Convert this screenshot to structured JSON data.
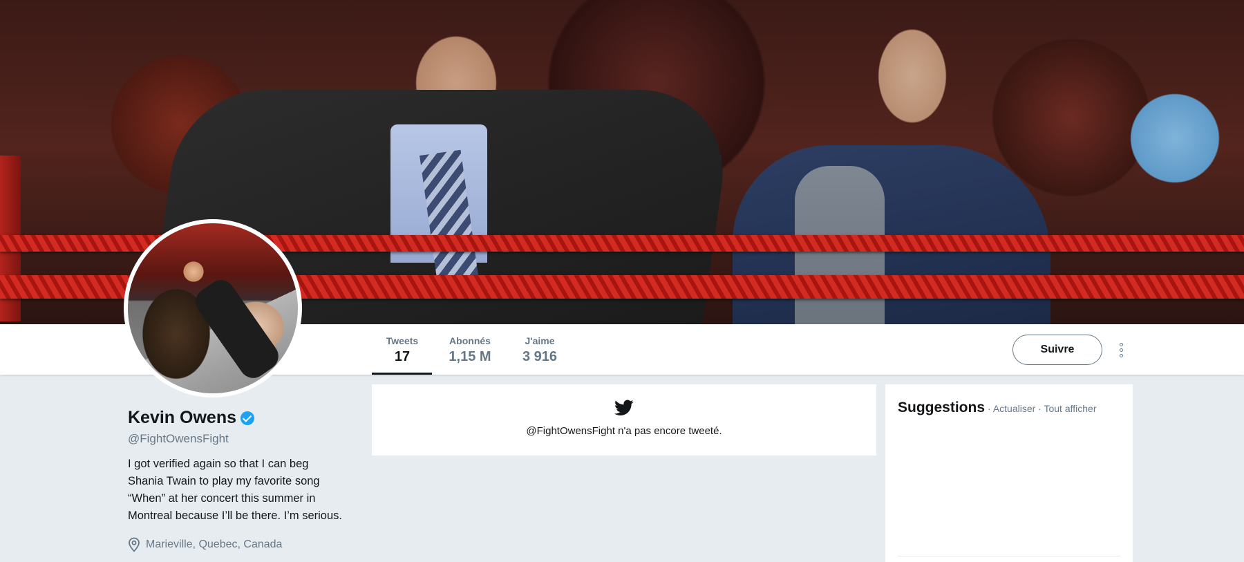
{
  "profile": {
    "name": "Kevin Owens",
    "handle": "@FightOwensFight",
    "verified": true,
    "bio": "I got verified again so that I can beg\nShania Twain to play my favorite song\n“When” at her concert this summer in\nMontreal because I’ll be there. I’m serious.",
    "location": "Marieville, Quebec, Canada",
    "location_icon": "map-pin-icon"
  },
  "nav": {
    "stats": [
      {
        "label": "Tweets",
        "value": "17",
        "active": true
      },
      {
        "label": "Abonnés",
        "value": "1,15 M",
        "active": false
      },
      {
        "label": "J'aime",
        "value": "3 916",
        "active": false
      }
    ],
    "follow_label": "Suivre",
    "more_icon": "more-vertical-icon"
  },
  "timeline": {
    "icon": "twitter-bird-icon",
    "empty_message": "@FightOwensFight n'a pas encore tweeté."
  },
  "suggestions": {
    "title": "Suggestions",
    "refresh_label": "Actualiser",
    "separator": "·",
    "view_all_label": "Tout afficher"
  },
  "colors": {
    "verified": "#1da1f2",
    "background": "#e6ecf0",
    "muted_text": "#657786",
    "primary_text": "#14171a"
  }
}
